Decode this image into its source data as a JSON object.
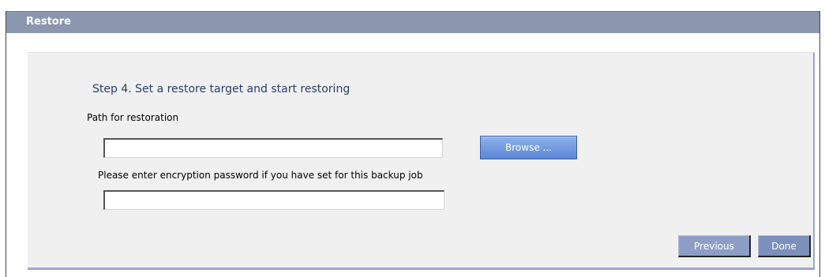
{
  "window": {
    "title": "Restore"
  },
  "step": {
    "title": "Step 4. Set a restore target and start restoring"
  },
  "path_field": {
    "label": "Path for restoration",
    "value": ""
  },
  "browse_button": {
    "label": "Browse ..."
  },
  "password_field": {
    "label": "Please enter encryption password if you have set for this backup job",
    "value": ""
  },
  "footer": {
    "previous_label": "Previous",
    "done_label": "Done"
  },
  "colors": {
    "titlebar": "#8b97ae",
    "panel_background": "#f0f0f0",
    "panel_border": "#9aa9c8",
    "step_title": "#2b3d6b",
    "browse_button": "#5a86d6",
    "footer_button": "#8d9ec6"
  }
}
